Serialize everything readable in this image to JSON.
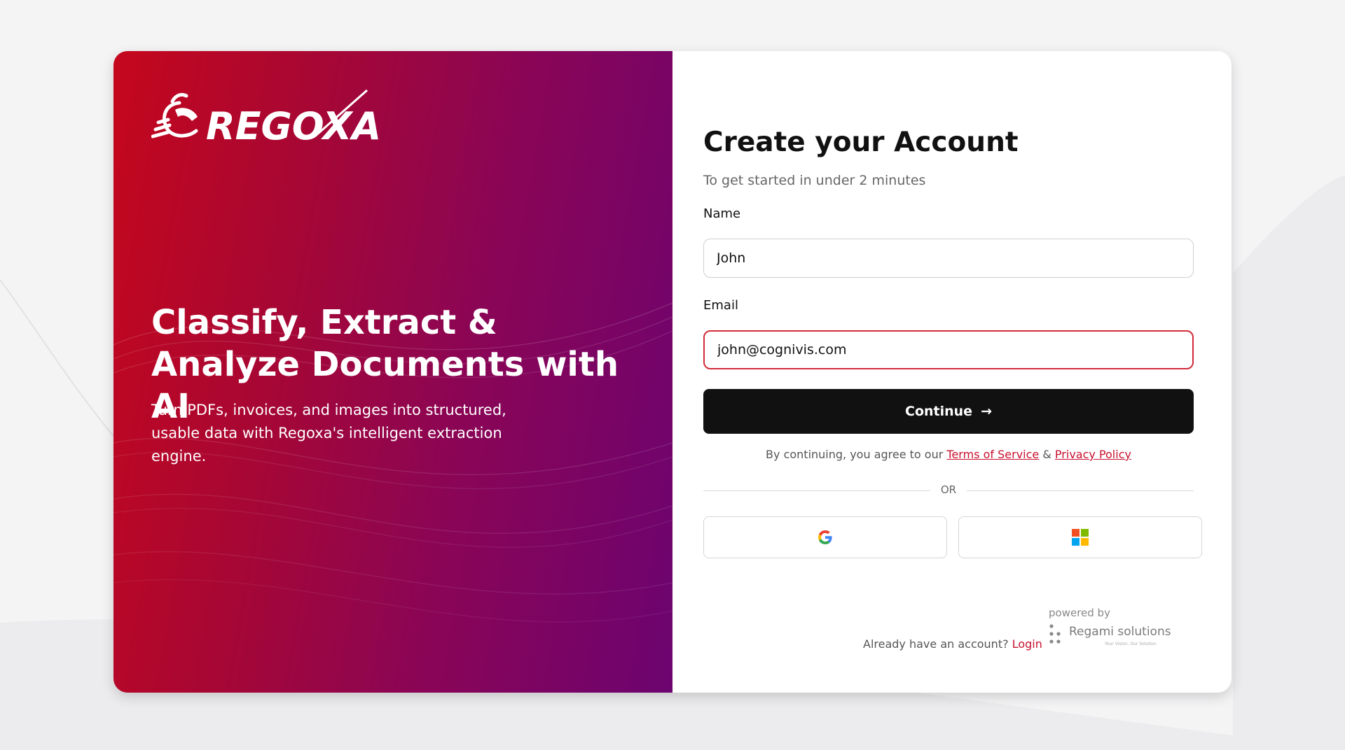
{
  "brand": {
    "name": "REGOXA"
  },
  "hero": {
    "headline": "Classify, Extract & Analyze Documents with AI",
    "subtext": "Turn PDFs, invoices, and images into structured, usable data with Regoxa's intelligent extraction engine."
  },
  "form": {
    "title": "Create your Account",
    "subtitle": "To get started in under 2 minutes",
    "name_label": "Name",
    "name_value": "John",
    "email_label": "Email",
    "email_value": "john@cognivis.com",
    "continue_label": "Continue",
    "continue_arrow": "→",
    "agree_prefix": "By continuing, you agree to our",
    "terms_label": "Terms of Service",
    "agree_and": "&",
    "privacy_label": "Privacy Policy",
    "or_label": "OR"
  },
  "social": {
    "google_icon": "google-icon",
    "microsoft_icon": "microsoft-icon"
  },
  "footer": {
    "have_account": "Already have an account?",
    "login_label": "Login",
    "powered_by": "powered by",
    "partner_name": "Regami solutions",
    "partner_tagline": "Your Vision, Our Solution"
  },
  "colors": {
    "accent": "#c8102e",
    "hero_gradient_start": "#c5071c",
    "hero_gradient_end": "#6c0470",
    "button_bg": "#111111",
    "focus_border": "#d12b3a"
  }
}
